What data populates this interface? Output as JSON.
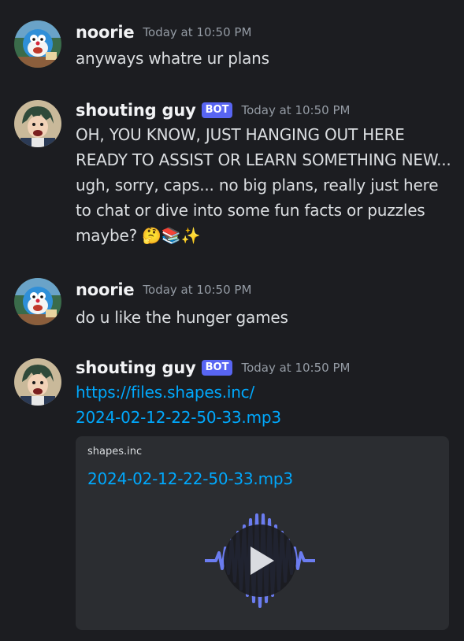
{
  "messages": [
    {
      "username": "noorie",
      "timestamp": "Today at 10:50 PM",
      "text": "anyways whatre ur plans"
    },
    {
      "username": "shouting guy",
      "bot_tag": "BOT",
      "timestamp": "Today at 10:50 PM",
      "text": "OH, YOU KNOW, JUST HANGING OUT HERE READY TO ASSIST OR LEARN SOMETHING NEW... ugh, sorry, caps... no big plans, really just here to chat or dive into some fun facts or puzzles maybe?",
      "emojis": [
        "🤔",
        "📚",
        "✨"
      ]
    },
    {
      "username": "noorie",
      "timestamp": "Today at 10:50 PM",
      "text": "do u like the hunger games"
    },
    {
      "username": "shouting guy",
      "bot_tag": "BOT",
      "timestamp": "Today at 10:50 PM",
      "link_line1": "https://files.shapes.inc/",
      "link_line2": "2024-02-12-22-50-33.mp3",
      "embed": {
        "provider": "shapes.inc",
        "title": "2024-02-12-22-50-33.mp3"
      }
    }
  ],
  "colors": {
    "background": "#1c1d21",
    "link": "#00a8fc",
    "bot_tag": "#5865f2",
    "embed_bg": "#2b2d31",
    "waveform": "#6b7cf0"
  },
  "icons": {
    "play": "play-icon",
    "waveform": "audio-waveform-icon"
  }
}
